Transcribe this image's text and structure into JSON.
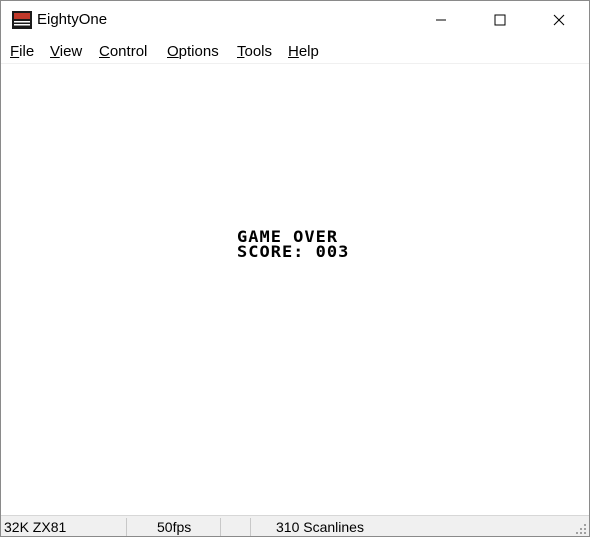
{
  "window": {
    "title": "EightyOne",
    "icon": "zx81-computer-icon"
  },
  "titlebar_buttons": {
    "minimize_icon": "minimize-icon",
    "maximize_icon": "maximize-icon",
    "close_icon": "close-icon"
  },
  "menu": {
    "items": [
      {
        "accel": "F",
        "rest": "ile"
      },
      {
        "accel": "V",
        "rest": "iew"
      },
      {
        "accel": "C",
        "rest": "ontrol"
      },
      {
        "accel": "O",
        "rest": "ptions"
      },
      {
        "accel": "T",
        "rest": "ools"
      },
      {
        "accel": "H",
        "rest": "elp"
      }
    ]
  },
  "screen": {
    "line1": "GAME OVER",
    "line2": "SCORE: 003"
  },
  "status": {
    "machine": "32K ZX81",
    "fps": "50fps",
    "scanlines": "310 Scanlines"
  },
  "colors": {
    "window_bg": "#ffffff",
    "statusbar_bg": "#f0f0f0",
    "text": "#000000"
  }
}
